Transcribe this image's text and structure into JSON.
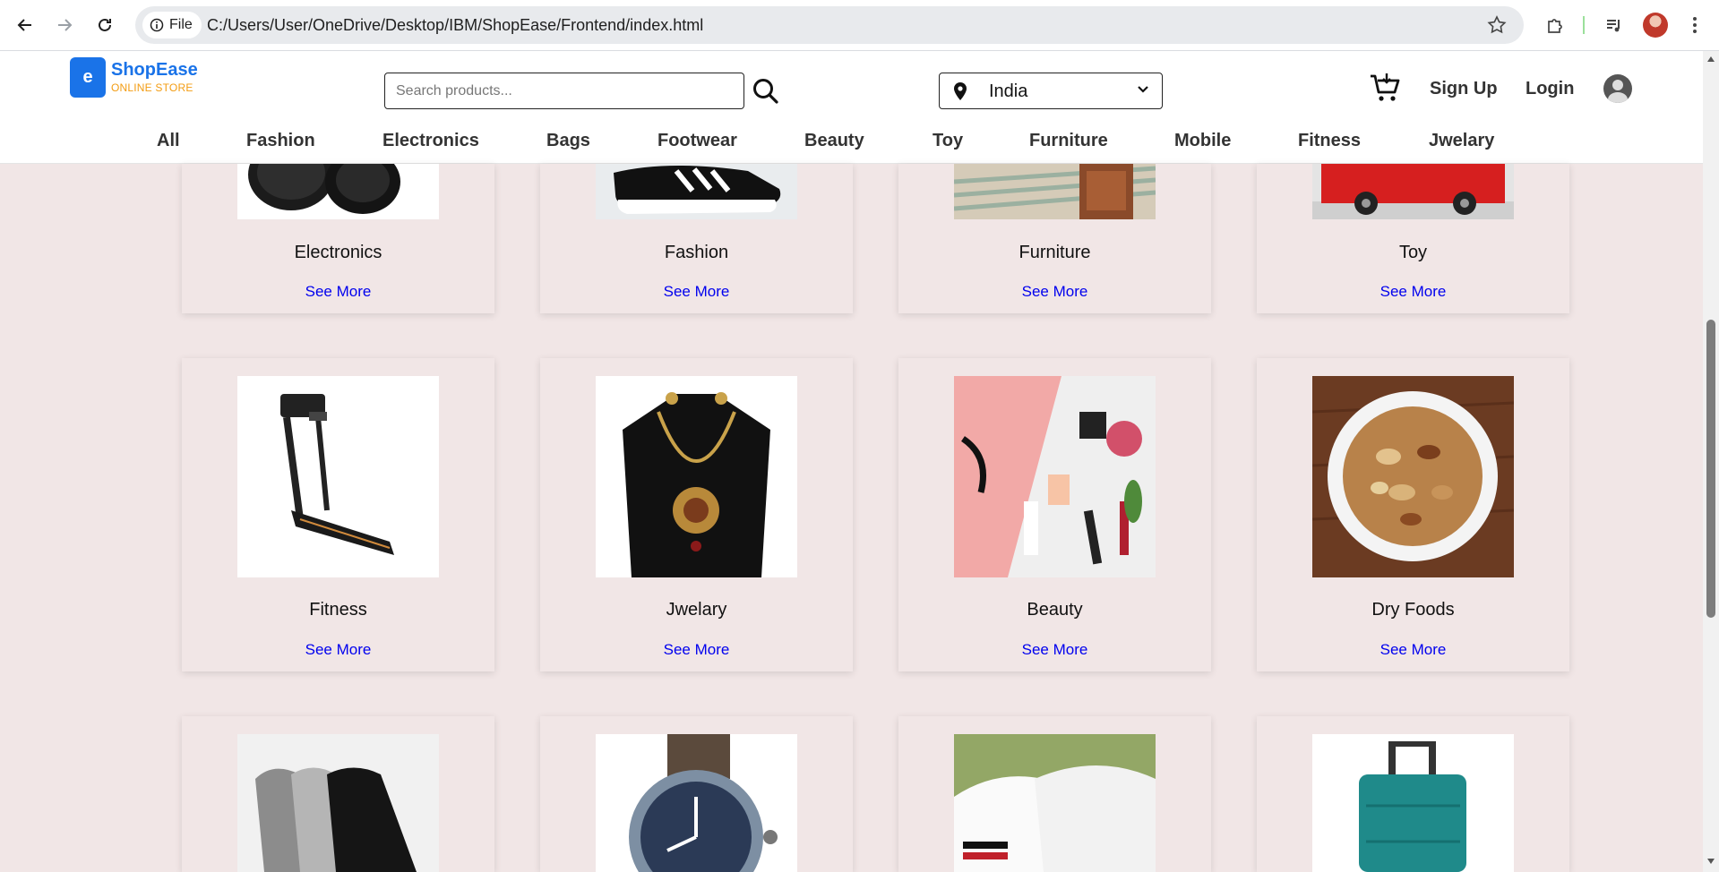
{
  "browser": {
    "site_chip_label": "File",
    "url": "C:/Users/User/OneDrive/Desktop/IBM/ShopEase/Frontend/index.html"
  },
  "header": {
    "logo_letter": "e",
    "logo_name": "ShopEase",
    "logo_tagline": "ONLINE STORE",
    "search_placeholder": "Search products...",
    "location": "India",
    "signup_label": "Sign Up",
    "login_label": "Login"
  },
  "categories_nav": [
    "All",
    "Fashion",
    "Electronics",
    "Bags",
    "Footwear",
    "Beauty",
    "Toy",
    "Furniture",
    "Mobile",
    "Fitness",
    "Jwelary"
  ],
  "cards": [
    {
      "title": "Electronics",
      "link": "See More",
      "image": "headphones"
    },
    {
      "title": "Fashion",
      "link": "See More",
      "image": "sneaker"
    },
    {
      "title": "Furniture",
      "link": "See More",
      "image": "furniture"
    },
    {
      "title": "Toy",
      "link": "See More",
      "image": "toy-car"
    },
    {
      "title": "Fitness",
      "link": "See More",
      "image": "treadmill"
    },
    {
      "title": "Jwelary",
      "link": "See More",
      "image": "necklace"
    },
    {
      "title": "Beauty",
      "link": "See More",
      "image": "cosmetics"
    },
    {
      "title": "Dry Foods",
      "link": "See More",
      "image": "nuts-bowl"
    },
    {
      "image": "socks"
    },
    {
      "image": "watch"
    },
    {
      "image": "white-sneakers"
    },
    {
      "image": "suitcase"
    }
  ],
  "colors": {
    "brand_blue": "#1a73e8",
    "brand_orange": "#f39c12",
    "page_background": "#f1e6e6",
    "link_blue": "#0000ee"
  }
}
